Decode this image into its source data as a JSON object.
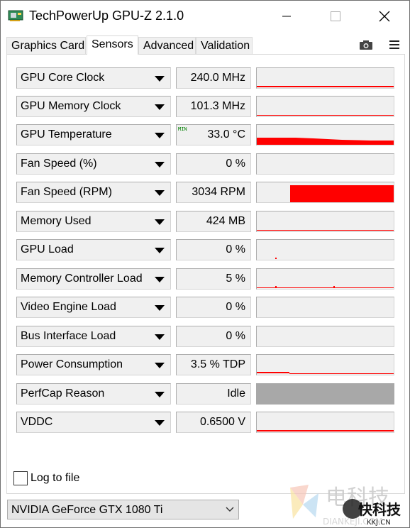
{
  "window": {
    "title": "TechPowerUp GPU-Z 2.1.0"
  },
  "tabs": [
    {
      "label": "Graphics Card"
    },
    {
      "label": "Sensors"
    },
    {
      "label": "Advanced"
    },
    {
      "label": "Validation"
    }
  ],
  "sensors": [
    {
      "name": "GPU Core Clock",
      "value": "240.0 MHz"
    },
    {
      "name": "GPU Memory Clock",
      "value": "101.3 MHz"
    },
    {
      "name": "GPU Temperature",
      "value": "33.0 °C",
      "min_label": "MIN"
    },
    {
      "name": "Fan Speed (%)",
      "value": "0 %"
    },
    {
      "name": "Fan Speed (RPM)",
      "value": "3034 RPM"
    },
    {
      "name": "Memory Used",
      "value": "424 MB"
    },
    {
      "name": "GPU Load",
      "value": "0 %"
    },
    {
      "name": "Memory Controller Load",
      "value": "5 %"
    },
    {
      "name": "Video Engine Load",
      "value": "0 %"
    },
    {
      "name": "Bus Interface Load",
      "value": "0 %"
    },
    {
      "name": "Power Consumption",
      "value": "3.5 % TDP"
    },
    {
      "name": "PerfCap Reason",
      "value": "Idle"
    },
    {
      "name": "VDDC",
      "value": "0.6500 V"
    }
  ],
  "log_to_file": {
    "label": "Log to file",
    "checked": false
  },
  "device_select": {
    "selected": "NVIDIA GeForce GTX 1080 Ti"
  },
  "watermark": {
    "text": "电科技",
    "sub": "DIANKEJI.COM",
    "overlay": "快科技",
    "overlay_sub": "KKJ.CN"
  },
  "colors": {
    "graph_line": "#ff0000",
    "graph_bg": "#f0f0f0",
    "perfcap_fill": "#a8a8a8"
  },
  "icons": {
    "app": "gpu-card-icon",
    "camera": "camera-icon",
    "menu": "hamburger-menu-icon",
    "minimize": "minimize-icon",
    "maximize": "maximize-icon",
    "close": "close-icon",
    "dropdown": "chevron-down-icon"
  }
}
